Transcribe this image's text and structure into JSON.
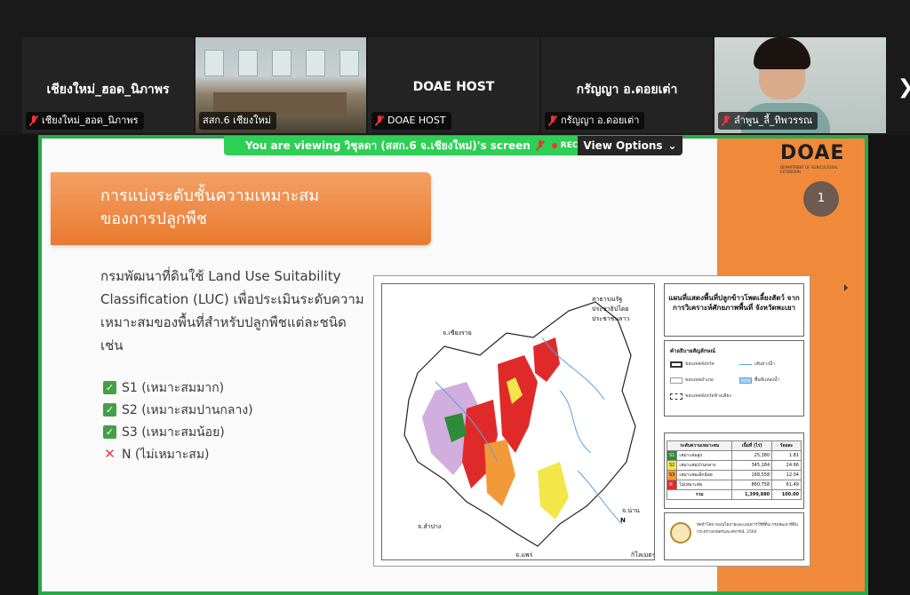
{
  "participants": [
    {
      "name": "เชียงใหม่_ฮอด_นิภาพร",
      "tag": "เชียงใหม่_ฮอด_นิภาพร",
      "muted": true
    },
    {
      "name": "",
      "tag": "สสก.6 เชียงใหม่",
      "muted": false,
      "video": "conference-room"
    },
    {
      "name": "DOAE HOST",
      "tag": "DOAE HOST",
      "muted": true
    },
    {
      "name": "กรัญญา อ.ดอยเต่า",
      "tag": "กรัญญา อ.ดอยเต่า",
      "muted": true
    },
    {
      "name": "",
      "tag": "ลำพูน_ลี้_ทิพวรรณ",
      "muted": true,
      "video": "person"
    }
  ],
  "next_icon": "chevron-right-icon",
  "viewing_bar": {
    "text": "You are viewing  วิชุลดา (สสก.6 จ.เชียงใหม่)'s screen",
    "rec_label": "REC",
    "view_options_label": "View Options"
  },
  "slide": {
    "logo": "DOAE",
    "logo_sub": "DEPARTMENT OF AGRICULTURAL EXTENSION",
    "page_number": "1",
    "banner_line1": "การแบ่งระดับชั้นความเหมาะสม",
    "banner_line2": "ของการปลูกพืช",
    "body": "กรมพัฒนาที่ดินใช้ Land Use Suitability Classification (LUC) เพื่อประเมินระดับความเหมาะสมของพื้นที่สำหรับปลูกพืชแต่ละชนิด เช่น",
    "bullets": [
      {
        "mark": "check",
        "text": "S1 (เหมาะสมมาก)"
      },
      {
        "mark": "check",
        "text": "S2 (เหมาะสมปานกลาง)"
      },
      {
        "mark": "check",
        "text": "S3 (เหมาะสมน้อย)"
      },
      {
        "mark": "cross",
        "text": "N (ไม่เหมาะสม)"
      }
    ]
  },
  "map": {
    "title": "แผนที่แสดงพื้นที่ปลูกข้าวโพดเลี้ยงสัตว์ จากการวิเคราะห์ศักยภาพพื้นที่ จังหวัดพะเยา",
    "labels": {
      "laos": "สาธารณรัฐประชาธิปไตยประชาชนลาว",
      "chiangrai": "จ.เชียงราย",
      "lampang": "จ.ลำปาง",
      "phrae": "จ.แพร่",
      "nan": "จ.น่าน",
      "scale": "กิโลเมตร",
      "north": "N"
    },
    "legend_title": "คำอธิบายสัญลักษณ์",
    "legend": [
      "ขอบเขตจังหวัด",
      "เส้นทางน้ำ",
      "ขอบเขตอำเภอ",
      "พื้นที่แหล่งน้ำ",
      "ขอบเขตจังหวัดข้างเคียง"
    ],
    "stats_headers": [
      "ระดับความเหมาะสม",
      "เนื้อที่ (ไร่)",
      "ร้อยละ"
    ],
    "stats_rows": [
      {
        "code": "S1",
        "label": "เหมาะสมสูง",
        "area": "25,380",
        "pct": "1.81",
        "color": "#2e8b3a"
      },
      {
        "code": "S2",
        "label": "เหมาะสมปานกลาง",
        "area": "345,184",
        "pct": "24.66",
        "color": "#f2e64a"
      },
      {
        "code": "S3",
        "label": "เหมาะสมเล็กน้อย",
        "area": "168,558",
        "pct": "12.04",
        "color": "#f29a3a"
      },
      {
        "code": "N",
        "label": "ไม่เหมาะสม",
        "area": "860,758",
        "pct": "61.49",
        "color": "#e02a2a"
      }
    ],
    "stats_total": {
      "label": "รวม",
      "area": "1,399,880",
      "pct": "100.00"
    },
    "credit": "จัดทำโดย กองนโยบายและแผนการใช้ที่ดิน กรมพัฒนาที่ดิน กระทรวงเกษตรและสหกรณ์, 2564"
  }
}
